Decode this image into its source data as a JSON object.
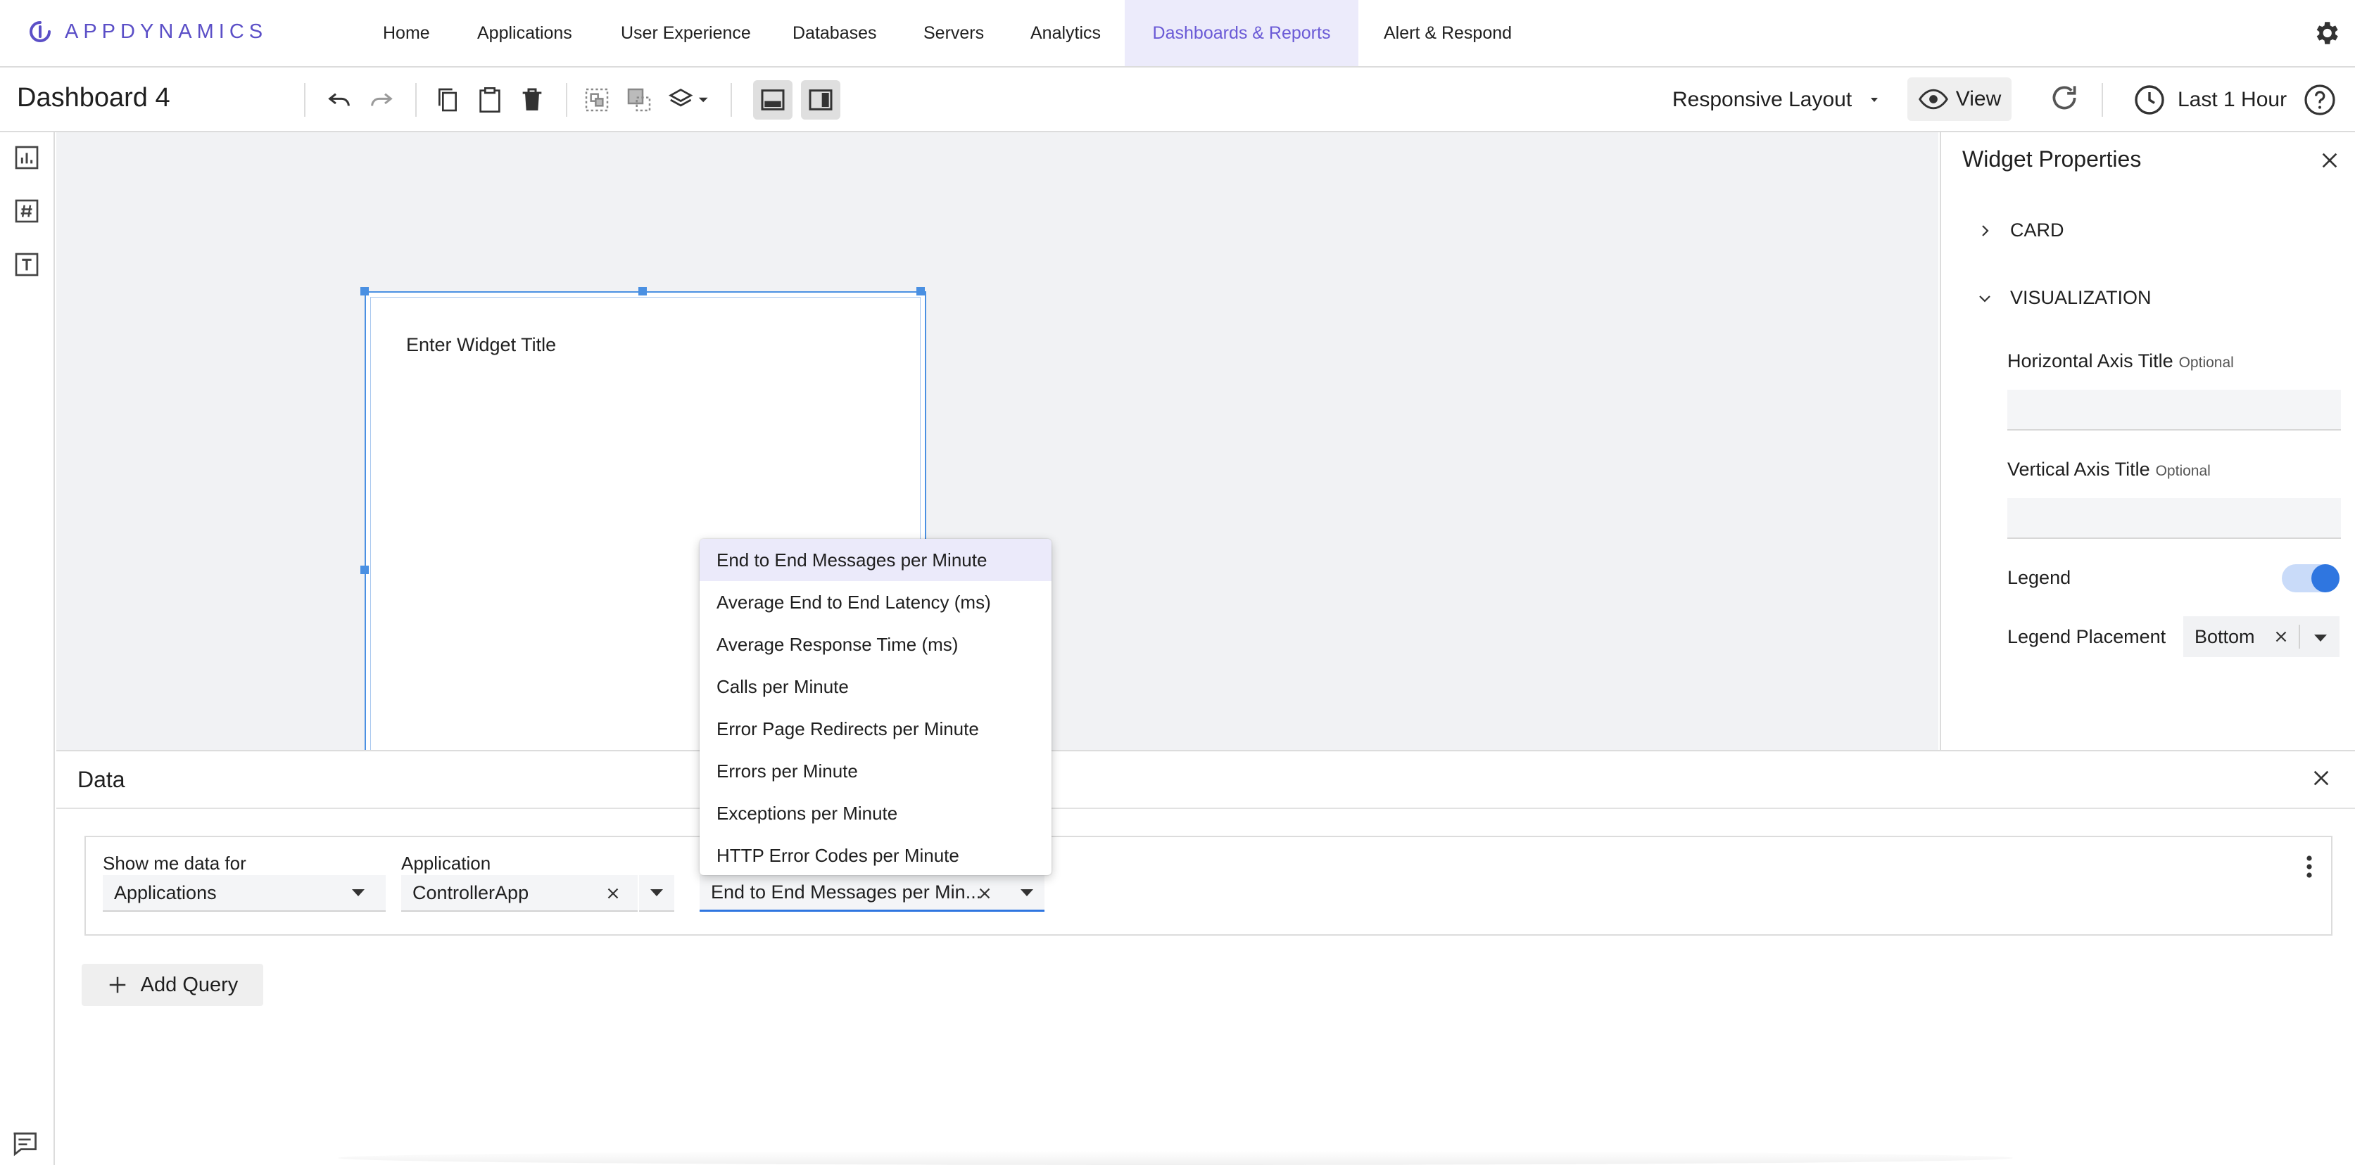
{
  "brand": {
    "logo_text": "APPDYNAMICS",
    "accent": "#6a5ad6",
    "selection_blue": "#4a90e2"
  },
  "nav": {
    "items": [
      {
        "label": "Home"
      },
      {
        "label": "Applications"
      },
      {
        "label": "User Experience"
      },
      {
        "label": "Databases"
      },
      {
        "label": "Servers"
      },
      {
        "label": "Analytics"
      },
      {
        "label": "Dashboards & Reports",
        "active": true
      },
      {
        "label": "Alert & Respond"
      }
    ],
    "settings_icon": "gear-icon"
  },
  "toolbar": {
    "title": "Dashboard 4",
    "layout_label": "Responsive Layout",
    "view_label": "View",
    "time_range": "Last 1 Hour",
    "icons": [
      "undo-icon",
      "redo-icon",
      "copy-icon",
      "paste-icon",
      "delete-icon",
      "group-icon",
      "ungroup-icon",
      "layers-icon",
      "layout-bottom-panel-icon",
      "layout-side-panel-icon",
      "eye-icon",
      "refresh-icon",
      "clock-icon",
      "help-icon"
    ]
  },
  "left_rail": {
    "icons": [
      "chart-widget-icon",
      "metric-number-icon",
      "text-widget-icon",
      "panel-toggle-icon"
    ]
  },
  "widget": {
    "title_placeholder": "Enter Widget Title"
  },
  "properties": {
    "title": "Widget Properties",
    "sections": [
      {
        "label": "CARD",
        "expanded": false
      },
      {
        "label": "VISUALIZATION",
        "expanded": true
      }
    ],
    "horizontal_axis": {
      "label": "Horizontal Axis Title",
      "optional": "Optional",
      "value": ""
    },
    "vertical_axis": {
      "label": "Vertical Axis Title",
      "optional": "Optional",
      "value": ""
    },
    "legend": {
      "label": "Legend",
      "enabled": true
    },
    "legend_placement": {
      "label": "Legend Placement",
      "value": "Bottom"
    }
  },
  "data_panel": {
    "title": "Data",
    "show_me_label": "Show me data for",
    "show_me_value": "Applications",
    "application_label": "Application",
    "application_value": "ControllerApp",
    "metric_value": "End to End Messages per Min...",
    "add_query_label": "Add Query"
  },
  "metric_menu": {
    "items": [
      {
        "label": "End to End Messages per Minute",
        "highlighted": true
      },
      {
        "label": "Average End to End Latency (ms)"
      },
      {
        "label": "Average Response Time (ms)"
      },
      {
        "label": "Calls per Minute"
      },
      {
        "label": "Error Page Redirects per Minute"
      },
      {
        "label": "Errors per Minute"
      },
      {
        "label": "Exceptions per Minute"
      },
      {
        "label": "HTTP Error Codes per Minute"
      }
    ]
  }
}
